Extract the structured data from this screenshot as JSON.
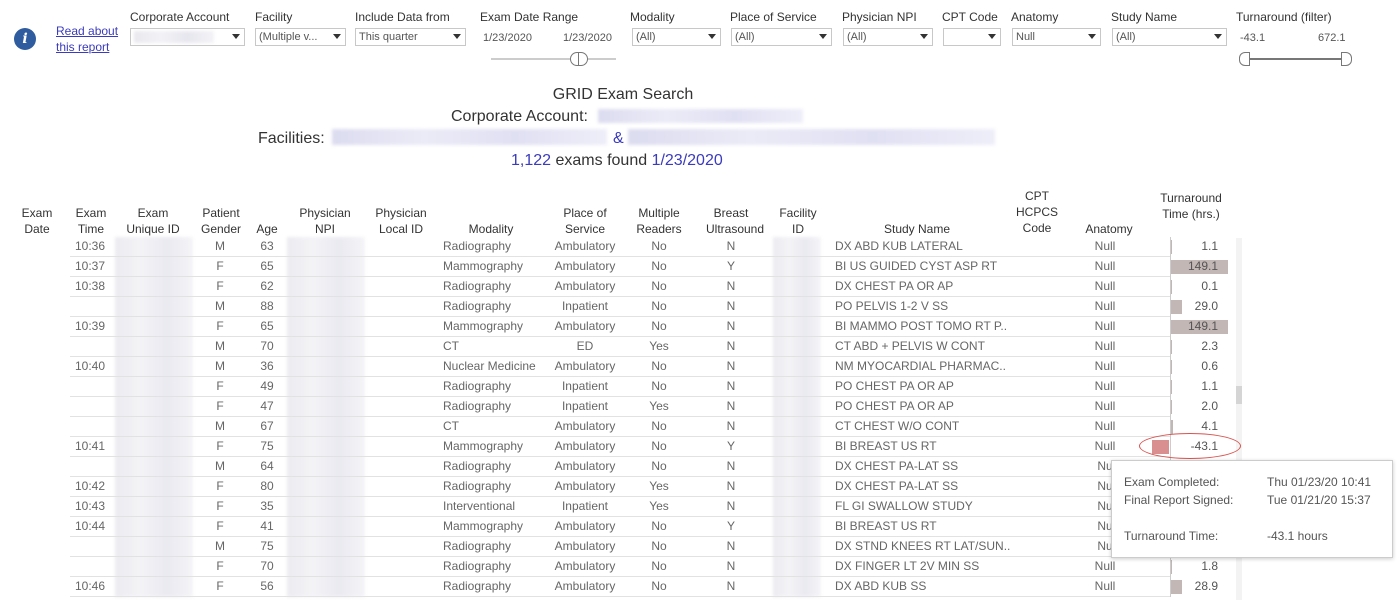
{
  "toolbar": {
    "info_icon": "i",
    "read_about_line1": "Read about",
    "read_about_line2": "this report"
  },
  "filters": {
    "corporate_account": {
      "label": "Corporate Account",
      "value": ""
    },
    "facility": {
      "label": "Facility",
      "value": "(Multiple v..."
    },
    "include_data": {
      "label": "Include Data from",
      "value": "This quarter"
    },
    "exam_date_range": {
      "label": "Exam Date Range",
      "start": "1/23/2020",
      "end": "1/23/2020"
    },
    "modality": {
      "label": "Modality",
      "value": "(All)"
    },
    "place_of_service": {
      "label": "Place of Service",
      "value": "(All)"
    },
    "physician_npi": {
      "label": "Physician NPI",
      "value": "(All)"
    },
    "cpt_code": {
      "label": "CPT Code",
      "value": ""
    },
    "anatomy": {
      "label": "Anatomy",
      "value": "Null"
    },
    "study_name": {
      "label": "Study Name",
      "value": "(All)"
    },
    "turnaround": {
      "label": "Turnaround (filter)",
      "min": "-43.1",
      "max": "672.1"
    }
  },
  "title": {
    "main": "GRID Exam Search",
    "corporate_label": "Corporate Account:",
    "facilities_label": "Facilities:",
    "amp": "&",
    "exam_count": "1,122",
    "exams_found": "exams found",
    "date": "1/23/2020"
  },
  "columns": {
    "exam_date": "Exam Date",
    "exam_time": "Exam Time",
    "exam_unique_id": "Exam Unique ID",
    "patient_gender": "Patient Gender",
    "age": "Age",
    "physician_npi": "Physician NPI",
    "physician_local_id": "Physician Local ID",
    "modality": "Modality",
    "place_of_service": "Place of Service",
    "multiple_readers": "Multiple Readers",
    "breast_ultrasound": "Breast Ultrasound",
    "facility_id": "Facility ID",
    "study_name": "Study Name",
    "cpt_code": "CPT HCPCS Code",
    "anatomy": "Anatomy",
    "turnaround": "Turnaround Time (hrs.)"
  },
  "rows": [
    {
      "time": "10:36",
      "gender": "M",
      "age": "63",
      "modality": "Radiography",
      "place": "Ambulatory",
      "multi": "No",
      "breast": "N",
      "study": "DX ABD KUB LATERAL",
      "anatomy": "Null",
      "tat": "1.1",
      "tat_value": 1.1
    },
    {
      "time": "10:37",
      "gender": "F",
      "age": "65",
      "modality": "Mammography",
      "place": "Ambulatory",
      "multi": "No",
      "breast": "Y",
      "study": "BI US GUIDED CYST ASP  RT",
      "anatomy": "Null",
      "tat": "149.1",
      "tat_value": 149.1
    },
    {
      "time": "10:38",
      "gender": "F",
      "age": "62",
      "modality": "Radiography",
      "place": "Ambulatory",
      "multi": "No",
      "breast": "N",
      "study": "DX CHEST PA OR AP",
      "anatomy": "Null",
      "tat": "0.1",
      "tat_value": 0.1
    },
    {
      "time": "",
      "gender": "M",
      "age": "88",
      "modality": "Radiography",
      "place": "Inpatient",
      "multi": "No",
      "breast": "N",
      "study": "PO PELVIS 1-2 V SS",
      "anatomy": "Null",
      "tat": "29.0",
      "tat_value": 29.0
    },
    {
      "time": "10:39",
      "gender": "F",
      "age": "65",
      "modality": "Mammography",
      "place": "Ambulatory",
      "multi": "No",
      "breast": "N",
      "study": "BI MAMMO POST TOMO RT P..",
      "anatomy": "Null",
      "tat": "149.1",
      "tat_value": 149.1
    },
    {
      "time": "",
      "gender": "M",
      "age": "70",
      "modality": "CT",
      "place": "ED",
      "multi": "Yes",
      "breast": "N",
      "study": "CT ABD + PELVIS W CONT",
      "anatomy": "Null",
      "tat": "2.3",
      "tat_value": 2.3
    },
    {
      "time": "10:40",
      "gender": "M",
      "age": "36",
      "modality": "Nuclear Medicine",
      "place": "Ambulatory",
      "multi": "No",
      "breast": "N",
      "study": "NM MYOCARDIAL PHARMAC..",
      "anatomy": "Null",
      "tat": "0.6",
      "tat_value": 0.6
    },
    {
      "time": "",
      "gender": "F",
      "age": "49",
      "modality": "Radiography",
      "place": "Inpatient",
      "multi": "No",
      "breast": "N",
      "study": "PO CHEST PA OR AP",
      "anatomy": "Null",
      "tat": "1.1",
      "tat_value": 1.1
    },
    {
      "time": "",
      "gender": "F",
      "age": "47",
      "modality": "Radiography",
      "place": "Inpatient",
      "multi": "Yes",
      "breast": "N",
      "study": "PO CHEST PA OR AP",
      "anatomy": "Null",
      "tat": "2.0",
      "tat_value": 2.0
    },
    {
      "time": "",
      "gender": "M",
      "age": "67",
      "modality": "CT",
      "place": "Ambulatory",
      "multi": "No",
      "breast": "N",
      "study": "CT CHEST W/O CONT",
      "anatomy": "Null",
      "tat": "4.1",
      "tat_value": 4.1
    },
    {
      "time": "10:41",
      "gender": "F",
      "age": "75",
      "modality": "Mammography",
      "place": "Ambulatory",
      "multi": "No",
      "breast": "Y",
      "study": "BI BREAST US RT",
      "anatomy": "Null",
      "tat": "-43.1",
      "tat_value": -43.1
    },
    {
      "time": "",
      "gender": "M",
      "age": "64",
      "modality": "Radiography",
      "place": "Ambulatory",
      "multi": "No",
      "breast": "N",
      "study": "DX CHEST PA-LAT SS",
      "anatomy": "Nu",
      "tat": "",
      "tat_value": null
    },
    {
      "time": "10:42",
      "gender": "F",
      "age": "80",
      "modality": "Radiography",
      "place": "Ambulatory",
      "multi": "Yes",
      "breast": "N",
      "study": "DX CHEST PA-LAT SS",
      "anatomy": "Nu",
      "tat": "",
      "tat_value": null
    },
    {
      "time": "10:43",
      "gender": "F",
      "age": "35",
      "modality": "Interventional",
      "place": "Inpatient",
      "multi": "Yes",
      "breast": "N",
      "study": "FL GI SWALLOW STUDY",
      "anatomy": "Nu",
      "tat": "",
      "tat_value": null
    },
    {
      "time": "10:44",
      "gender": "F",
      "age": "41",
      "modality": "Mammography",
      "place": "Ambulatory",
      "multi": "No",
      "breast": "Y",
      "study": "BI BREAST US RT",
      "anatomy": "Nu",
      "tat": "",
      "tat_value": null
    },
    {
      "time": "",
      "gender": "M",
      "age": "75",
      "modality": "Radiography",
      "place": "Ambulatory",
      "multi": "No",
      "breast": "N",
      "study": "DX STND KNEES RT LAT/SUN..",
      "anatomy": "Nu",
      "tat": "",
      "tat_value": null
    },
    {
      "time": "",
      "gender": "F",
      "age": "70",
      "modality": "Radiography",
      "place": "Ambulatory",
      "multi": "No",
      "breast": "N",
      "study": "DX FINGER LT 2V MIN SS",
      "anatomy": "Null",
      "tat": "1.8",
      "tat_value": 1.8
    },
    {
      "time": "10:46",
      "gender": "F",
      "age": "56",
      "modality": "Radiography",
      "place": "Ambulatory",
      "multi": "No",
      "breast": "N",
      "study": "DX ABD KUB SS",
      "anatomy": "Null",
      "tat": "28.9",
      "tat_value": 28.9
    }
  ],
  "tooltip": {
    "exam_completed_label": "Exam Completed:",
    "exam_completed_value": "Thu 01/23/20 10:41",
    "final_signed_label": "Final Report Signed:",
    "final_signed_value": "Tue 01/21/20 15:37",
    "tat_label": "Turnaround Time:",
    "tat_value": "-43.1 hours"
  },
  "colors": {
    "bar": "#c2b7b4",
    "negative_bar": "#d98f8f",
    "highlight_circle": "#d9534f",
    "link": "#3b3bbd"
  }
}
